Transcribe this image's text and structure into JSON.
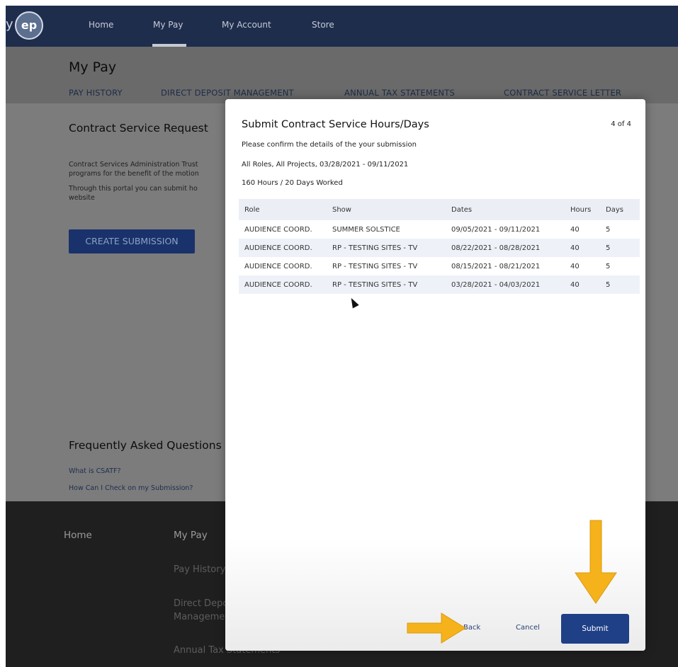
{
  "nav": {
    "logo_prefix": "y",
    "logo_text": "ep",
    "links": [
      "Home",
      "My Pay",
      "My Account",
      "Store"
    ]
  },
  "subheader": {
    "title": "My Pay",
    "tabs": [
      "PAY HISTORY",
      "DIRECT DEPOSIT MANAGEMENT",
      "ANNUAL TAX STATEMENTS",
      "CONTRACT SERVICE LETTER"
    ]
  },
  "page": {
    "request_title": "Contract Service Request",
    "text_lines": [
      "Contract Services Administration Trust",
      "programs for the benefit of the motion",
      "Through this portal you can submit ho",
      "website"
    ],
    "create_button": "CREATE SUBMISSION",
    "faq_title": "Frequently Asked Questions",
    "faq_links": [
      "What is CSATF?",
      "How Can I Check on my Submission?"
    ]
  },
  "footer": {
    "home": "Home",
    "my_pay": "My Pay",
    "items": [
      "Pay History",
      "Direct Deposit",
      "Management",
      "Annual Tax Statements"
    ]
  },
  "modal": {
    "title": "Submit Contract Service Hours/Days",
    "step": "4 of 4",
    "confirm_text": "Please confirm the details of the your submission",
    "summary_line": "All Roles, All Projects, 03/28/2021 - 09/11/2021",
    "totals_line": "160 Hours / 20 Days Worked",
    "columns": [
      "Role",
      "Show",
      "Dates",
      "Hours",
      "Days"
    ],
    "rows": [
      [
        "AUDIENCE COORD.",
        "SUMMER SOLSTICE",
        "09/05/2021 - 09/11/2021",
        "40",
        "5"
      ],
      [
        "AUDIENCE COORD.",
        "RP - TESTING SITES - TV",
        "08/22/2021 - 08/28/2021",
        "40",
        "5"
      ],
      [
        "AUDIENCE COORD.",
        "RP - TESTING SITES - TV",
        "08/15/2021 - 08/21/2021",
        "40",
        "5"
      ],
      [
        "AUDIENCE COORD.",
        "RP - TESTING SITES - TV",
        "03/28/2021 - 04/03/2021",
        "40",
        "5"
      ]
    ],
    "back_label": "Back",
    "cancel_label": "Cancel",
    "submit_label": "Submit"
  },
  "colors": {
    "nav_bg": "#1f2d4d",
    "primary_button": "#1f3f86",
    "annotation_arrow": "#f5b21b"
  }
}
